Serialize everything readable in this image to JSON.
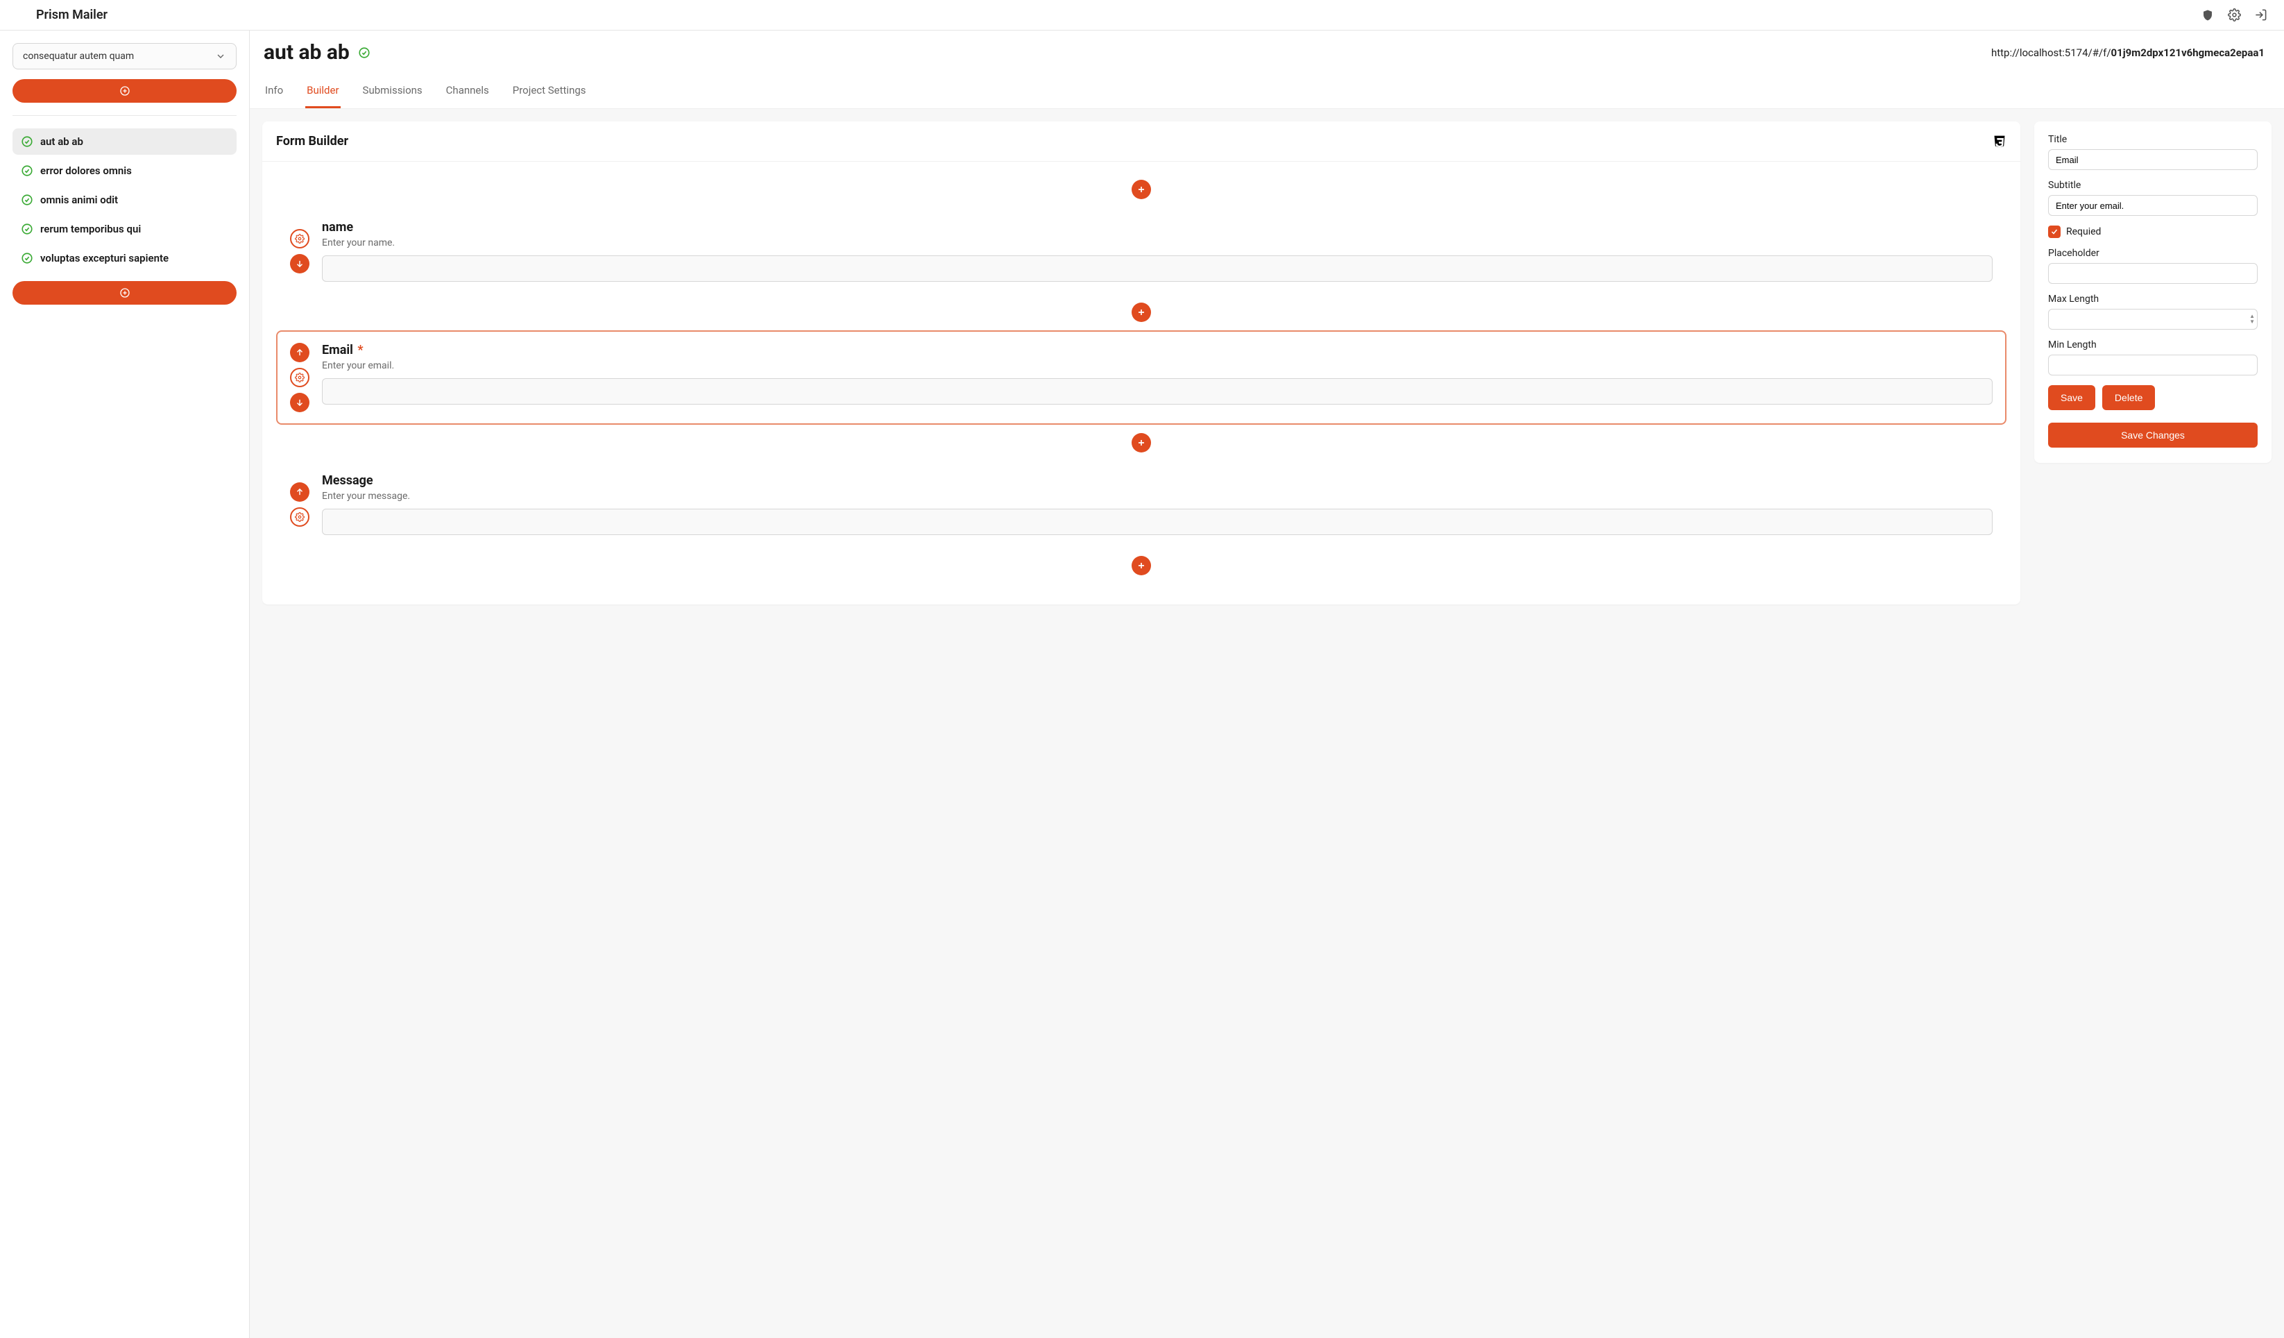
{
  "app": {
    "brand": "Prism Mailer"
  },
  "sidebar": {
    "project": "consequatur autem quam",
    "forms": [
      {
        "label": "aut ab ab",
        "active": true
      },
      {
        "label": "error dolores omnis",
        "active": false
      },
      {
        "label": "omnis animi odit",
        "active": false
      },
      {
        "label": "rerum temporibus qui",
        "active": false
      },
      {
        "label": "voluptas excepturi sapiente",
        "active": false
      }
    ]
  },
  "header": {
    "title": "aut ab ab",
    "url_prefix": "http://localhost:5174/#/f/",
    "url_id": "01j9m2dpx121v6hgmeca2epaa1",
    "tabs": [
      {
        "label": "Info",
        "active": false
      },
      {
        "label": "Builder",
        "active": true
      },
      {
        "label": "Submissions",
        "active": false
      },
      {
        "label": "Channels",
        "active": false
      },
      {
        "label": "Project Settings",
        "active": false
      }
    ]
  },
  "builder": {
    "panel_title": "Form Builder",
    "fields": [
      {
        "title": "name",
        "subtitle": "Enter your name.",
        "required": false,
        "has_up": false,
        "has_down": true,
        "selected": false
      },
      {
        "title": "Email",
        "subtitle": "Enter your email.",
        "required": true,
        "has_up": true,
        "has_down": true,
        "selected": true
      },
      {
        "title": "Message",
        "subtitle": "Enter your message.",
        "required": false,
        "has_up": true,
        "has_down": false,
        "selected": false
      }
    ]
  },
  "props": {
    "title_label": "Title",
    "title_value": "Email",
    "subtitle_label": "Subtitle",
    "subtitle_value": "Enter your email.",
    "required_label": "Requied",
    "required_checked": true,
    "placeholder_label": "Placeholder",
    "placeholder_value": "",
    "max_len_label": "Max Length",
    "max_len_value": "",
    "min_len_label": "Min Length",
    "min_len_value": "",
    "save_label": "Save",
    "delete_label": "Delete",
    "save_changes_label": "Save Changes"
  }
}
